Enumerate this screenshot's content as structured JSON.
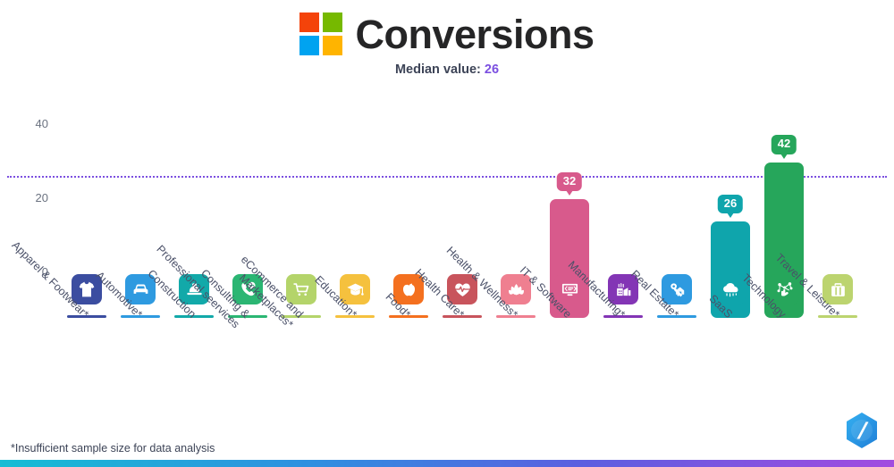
{
  "header": {
    "title": "Conversions",
    "logo_name": "microsoft-squares-logo",
    "logo_colors": [
      "#f4430a",
      "#76b900",
      "#00a3f0",
      "#ffb400"
    ],
    "subtitle_prefix": "Median value:",
    "subtitle_value": "26",
    "subtitle_value_color": "#7b4fe0"
  },
  "footer": {
    "footnote": "*Insufficient sample size for data analysis",
    "badge_name": "hexagon-badge-logo",
    "badge_color": "#2196e8",
    "gradient_start": "#16bdd4",
    "gradient_end": "#a24be0"
  },
  "chart_data": {
    "type": "bar",
    "title": "Conversions",
    "xlabel": "",
    "ylabel": "",
    "ylim": [
      0,
      46
    ],
    "yticks": [
      0,
      20,
      40
    ],
    "grid": false,
    "legend": false,
    "median_line": {
      "value": 26,
      "label": "Median value: 26",
      "color": "#7b4fe0",
      "style": "dotted"
    },
    "annotation": "*Insufficient sample size for data analysis",
    "categories": [
      "Apparel & Footwear*",
      "Automotive*",
      "Construction",
      "Consulting &\nProfessional seervices",
      "eCommerce and\nMarketplaces*",
      "Education*",
      "Food*",
      "Health Care*",
      "Health & Wellness*",
      "IT & Software",
      "Manufacturing*",
      "Real Estate*",
      "SaaS",
      "Technology",
      "Travel & Leisure*"
    ],
    "values": [
      0,
      0,
      0,
      0,
      0,
      0,
      0,
      0,
      0,
      32,
      0,
      0,
      26,
      42,
      0
    ],
    "value_labels": [
      "",
      "",
      "",
      "",
      "",
      "",
      "",
      "",
      "",
      "32",
      "",
      "",
      "26",
      "42",
      ""
    ],
    "colors": [
      "#3b4da0",
      "#2e9ae0",
      "#12a9a9",
      "#2bb673",
      "#b4d46a",
      "#f5c13e",
      "#f4701f",
      "#c8545c",
      "#ef7f90",
      "#d85a8c",
      "#8335b5",
      "#2e9ae0",
      "#0fa5ac",
      "#26a65b",
      "#bcd46f"
    ],
    "icons": [
      "tshirt-icon",
      "car-icon",
      "hardhat-icon",
      "phone-chat-icon",
      "shopping-cart-icon",
      "graduation-cap-icon",
      "apple-icon",
      "heart-pulse-icon",
      "lotus-icon",
      "monitor-code-icon",
      "factory-icon",
      "key-house-icon",
      "cloud-icon",
      "network-hand-icon",
      "suitcase-icon"
    ]
  }
}
